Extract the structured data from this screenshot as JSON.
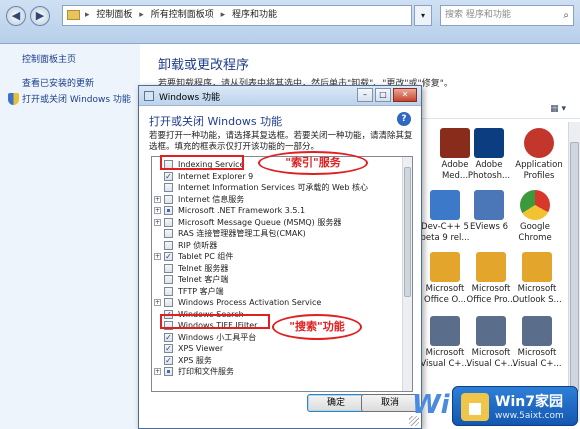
{
  "address_bar": {
    "crumbs": [
      "控制面板",
      "所有控制面板项",
      "程序和功能"
    ],
    "search_placeholder": "搜索 程序和功能"
  },
  "left_pane": {
    "home": "控制面板主页",
    "view_updates": "查看已安装的更新",
    "toggle_features": "打开或关闭 Windows 功能"
  },
  "main": {
    "title": "卸载或更改程序",
    "description": "若要卸载程序，请从列表中将其选中，然后单击\"卸载\"、\"更改\"或\"修复\"。",
    "apps": [
      {
        "label": "Adobe Med...",
        "color": "#8a2c1c"
      },
      {
        "label": "Adobe Photosh...",
        "color": "#0b3d80"
      },
      {
        "label": "Application Profiles",
        "color": "#c2362b"
      },
      {
        "label": "Dev-C++ 5 beta 9 rel...",
        "color": "#3c7ac9"
      },
      {
        "label": "EViews 6",
        "color": "#4b76b7"
      },
      {
        "label": "Google Chrome",
        "color": "#3b9a3b"
      },
      {
        "label": "Microsoft Office O...",
        "color": "#e3a52b"
      },
      {
        "label": "Microsoft Office Pro...",
        "color": "#e3a52b"
      },
      {
        "label": "Microsoft Outlook S...",
        "color": "#e3a52b"
      },
      {
        "label": "Microsoft Visual C+...",
        "color": "#5a6d8a"
      },
      {
        "label": "Microsoft Visual C+...",
        "color": "#5a6d8a"
      },
      {
        "label": "Microsoft Visual C+...",
        "color": "#5a6d8a"
      }
    ]
  },
  "dialog": {
    "title": "Windows 功能",
    "heading": "打开或关闭 Windows 功能",
    "description": "若要打开一种功能，请选择其复选框。若要关闭一种功能，请清除其复选框。填充的框表示仅打开该功能的一部分。",
    "features": [
      {
        "label": "Indexing Service",
        "state": "unchecked",
        "expandable": false
      },
      {
        "label": "Internet Explorer 9",
        "state": "checked",
        "expandable": false
      },
      {
        "label": "Internet Information Services 可承载的 Web 核心",
        "state": "unchecked",
        "expandable": false
      },
      {
        "label": "Internet 信息服务",
        "state": "unchecked",
        "expandable": true
      },
      {
        "label": "Microsoft .NET Framework 3.5.1",
        "state": "partial",
        "expandable": true
      },
      {
        "label": "Microsoft Message Queue (MSMQ) 服务器",
        "state": "unchecked",
        "expandable": true
      },
      {
        "label": "RAS 连接管理器管理工具包(CMAK)",
        "state": "unchecked",
        "expandable": false
      },
      {
        "label": "RIP 侦听器",
        "state": "unchecked",
        "expandable": false
      },
      {
        "label": "Tablet PC 组件",
        "state": "checked",
        "expandable": true
      },
      {
        "label": "Telnet 服务器",
        "state": "unchecked",
        "expandable": false
      },
      {
        "label": "Telnet 客户端",
        "state": "unchecked",
        "expandable": false
      },
      {
        "label": "TFTP 客户端",
        "state": "unchecked",
        "expandable": false
      },
      {
        "label": "Windows Process Activation Service",
        "state": "unchecked",
        "expandable": true
      },
      {
        "label": "Windows Search",
        "state": "checked",
        "expandable": false
      },
      {
        "label": "Windows TIFF IFilter",
        "state": "unchecked",
        "expandable": false
      },
      {
        "label": "Windows 小工具平台",
        "state": "checked",
        "expandable": false
      },
      {
        "label": "XPS Viewer",
        "state": "checked",
        "expandable": false
      },
      {
        "label": "XPS 服务",
        "state": "checked",
        "expandable": false
      },
      {
        "label": "打印和文件服务",
        "state": "partial",
        "expandable": true
      }
    ],
    "ok": "确定",
    "cancel": "取消"
  },
  "annotations": {
    "indexing": "\"索引\"服务",
    "search": "\"搜索\"功能"
  },
  "watermark": {
    "big": "Wi",
    "title": "Win7家园",
    "url": "www.5aixt.com"
  }
}
